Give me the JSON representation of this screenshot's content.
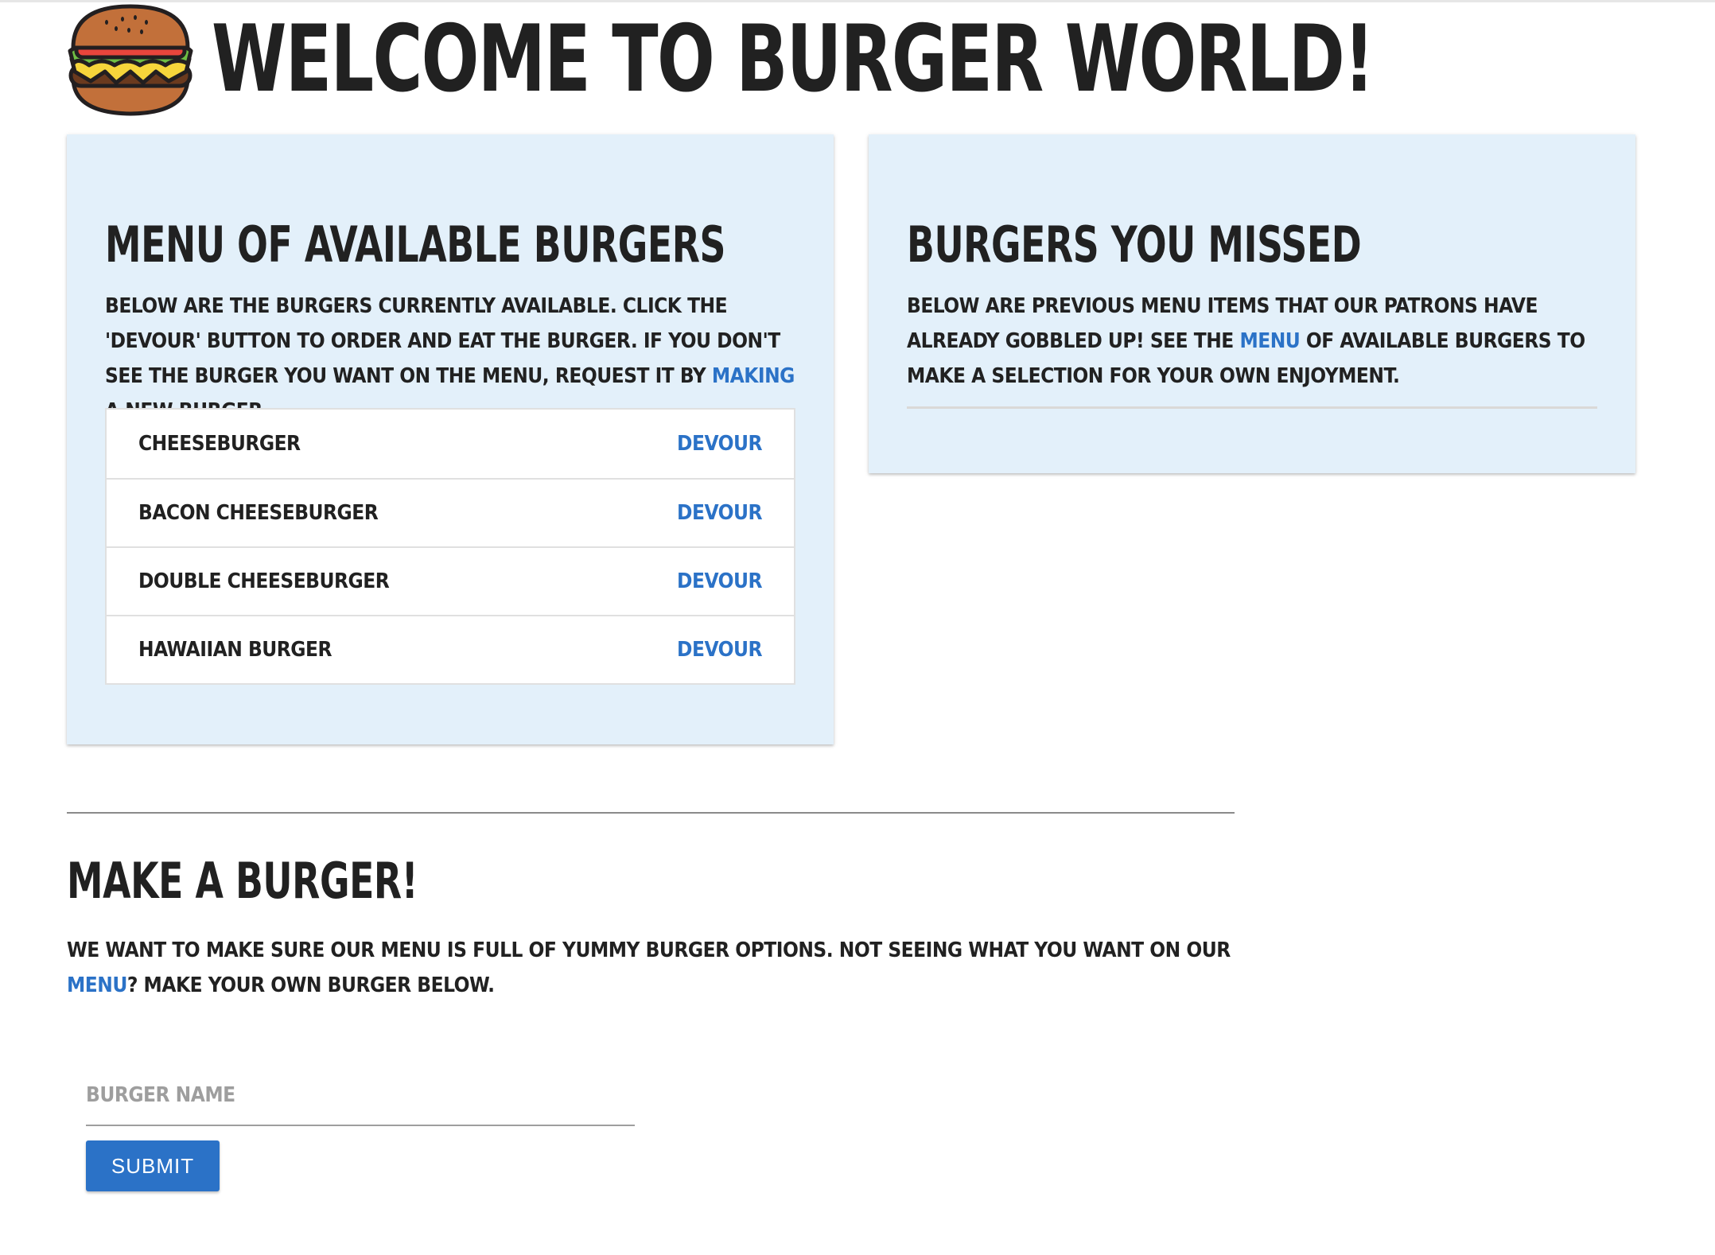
{
  "header": {
    "title": "WELCOME TO BURGER WORLD!",
    "logo_icon": "burger-icon"
  },
  "menu_card": {
    "title": "MENU OF AVAILABLE BURGERS",
    "text_before_link": "BELOW ARE THE BURGERS CURRENTLY AVAILABLE. CLICK THE 'DEVOUR' BUTTON TO ORDER AND EAT THE BURGER. IF YOU DON'T SEE THE BURGER YOU WANT ON THE MENU, REQUEST IT BY ",
    "link_text": "MAKING",
    "text_after_link": " A NEW BURGER.",
    "burgers": [
      {
        "name": "CHEESEBURGER",
        "action": "DEVOUR"
      },
      {
        "name": "BACON CHEESEBURGER",
        "action": "DEVOUR"
      },
      {
        "name": "DOUBLE CHEESEBURGER",
        "action": "DEVOUR"
      },
      {
        "name": "HAWAIIAN BURGER",
        "action": "DEVOUR"
      }
    ]
  },
  "missed_card": {
    "title": "BURGERS YOU MISSED",
    "text_before_link": "BELOW ARE PREVIOUS MENU ITEMS THAT OUR PATRONS HAVE ALREADY GOBBLED UP! SEE THE ",
    "link_text": "MENU",
    "text_after_link": " OF AVAILABLE BURGERS TO MAKE A SELECTION FOR YOUR OWN ENJOYMENT."
  },
  "make_section": {
    "title": "MAKE A BURGER!",
    "text_before_link": "WE WANT TO MAKE SURE OUR MENU IS FULL OF YUMMY BURGER OPTIONS. NOT SEEING WHAT YOU WANT ON OUR ",
    "link_text": "MENU",
    "text_after_link": "? MAKE YOUR OWN BURGER BELOW.",
    "input_placeholder": "BURGER NAME",
    "input_value": "",
    "submit_label": "SUBMIT"
  },
  "colors": {
    "card_background": "#e3f0fa",
    "link": "#2b72c7",
    "button": "#2b72c7",
    "text": "#212121"
  }
}
